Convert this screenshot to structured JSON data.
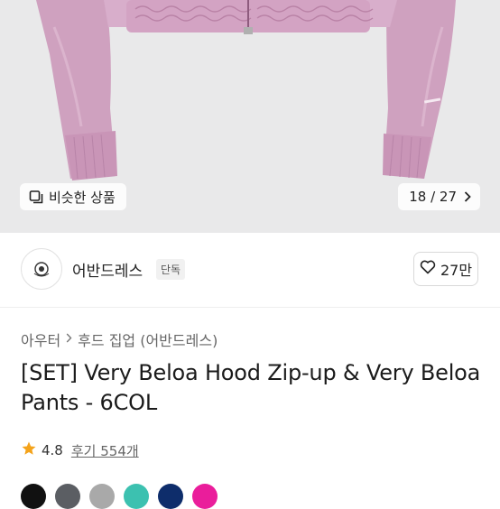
{
  "gallery": {
    "similar_label": "비슷한 상품",
    "counter": "18 / 27"
  },
  "store": {
    "name": "어반드레스",
    "badge": "단독",
    "likes": "27만"
  },
  "breadcrumb": [
    "아우터",
    "후드 집업 (어반드레스)"
  ],
  "product": {
    "title": "[SET] Very Beloa Hood Zip-up & Very Beloa Pants - 6COL",
    "rating": "4.8",
    "reviews": "후기 554개"
  },
  "colors": [
    "#111111",
    "#5b5e63",
    "#a9a9a9",
    "#3cc1b0",
    "#0e2d6b",
    "#ea1d9b"
  ]
}
